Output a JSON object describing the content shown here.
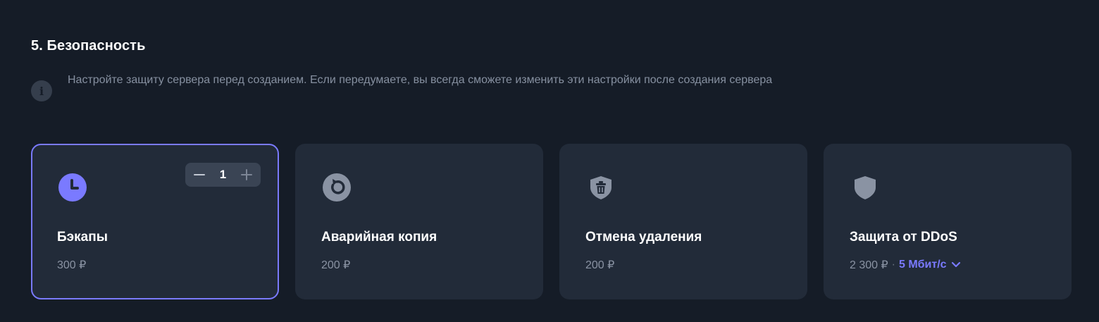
{
  "section": {
    "title": "5. Безопасность",
    "notice": "Настройте защиту сервера перед созданием. Если передумаете, вы всегда сможете изменить эти настройки после создания сервера",
    "notice_icon": "info-icon"
  },
  "colors": {
    "background": "#151c27",
    "card": "#222b39",
    "accent": "#7a7aff",
    "muted_text": "#8a93a3",
    "icon_gray": "#8a93a3"
  },
  "cards": [
    {
      "title": "Бэкапы",
      "price": "300 ₽",
      "icon": "clock-icon",
      "selected": true,
      "stepper_value": "1"
    },
    {
      "title": "Аварийная копия",
      "price": "200 ₽",
      "icon": "restore-icon",
      "selected": false
    },
    {
      "title": "Отмена удаления",
      "price": "200 ₽",
      "icon": "trash-shield-icon",
      "selected": false
    },
    {
      "title": "Защита от DDoS",
      "price": "2 300 ₽",
      "separator": "·",
      "speed": "5 Мбит/с",
      "icon": "shield-icon",
      "selected": false
    }
  ]
}
